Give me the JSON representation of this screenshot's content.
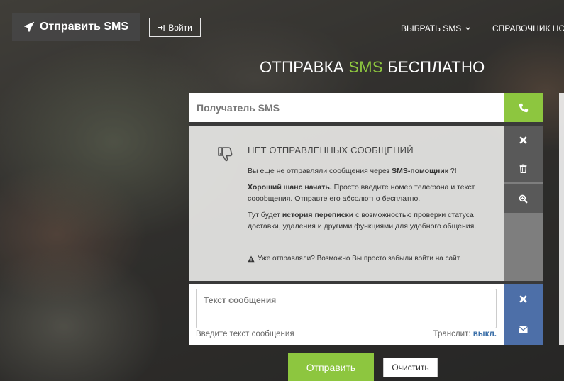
{
  "header": {
    "brand_label": "Отправить SMS",
    "login_label": "Войти",
    "nav": [
      {
        "label": "ВЫБРАТЬ SMS"
      },
      {
        "label": "СПРАВОЧНИК НО"
      }
    ]
  },
  "title": {
    "prefix": "ОТПРАВКА ",
    "accent": "SMS",
    "suffix": " БЕСПЛАТНО"
  },
  "recipient": {
    "placeholder": "Получатель SMS"
  },
  "history": {
    "title": "НЕТ ОТПРАВЛЕННЫХ СООБЩЕНИЙ",
    "p1_text": "Вы еще не отправляли сообщения через ",
    "p1_bold": "SMS-помощник",
    "p1_end": " ?!",
    "p2_bold": "Хороший шанс начать.",
    "p2_text": " Просто введите номер телефона и текст сооobщения. Отправте его абсолютно бесплатно.",
    "p3_text": "Тут будет ",
    "p3_bold": "история переписки",
    "p3_end": " с возможностью проверки статуса доставки, удаления и другими функциями для удобного общения.",
    "note": "Уже отправляли? Возможно Вы просто забыли войти на сайт."
  },
  "compose": {
    "placeholder": "Текст сообщения",
    "hint": "Введите текст сообщения",
    "translit_label": "Транслит: ",
    "translit_value": "выкл."
  },
  "buttons": {
    "send": "Отправить",
    "clear": "Очистить"
  },
  "colors": {
    "accent": "#8dc63f",
    "blue": "#4d6fa8",
    "dark": "#595959"
  },
  "icons": [
    "paper-plane-icon",
    "sign-in-icon",
    "chevron-down-icon",
    "phone-icon",
    "thumbs-down-icon",
    "close-icon",
    "trash-icon",
    "zoom-in-icon",
    "warning-icon",
    "envelope-icon"
  ]
}
